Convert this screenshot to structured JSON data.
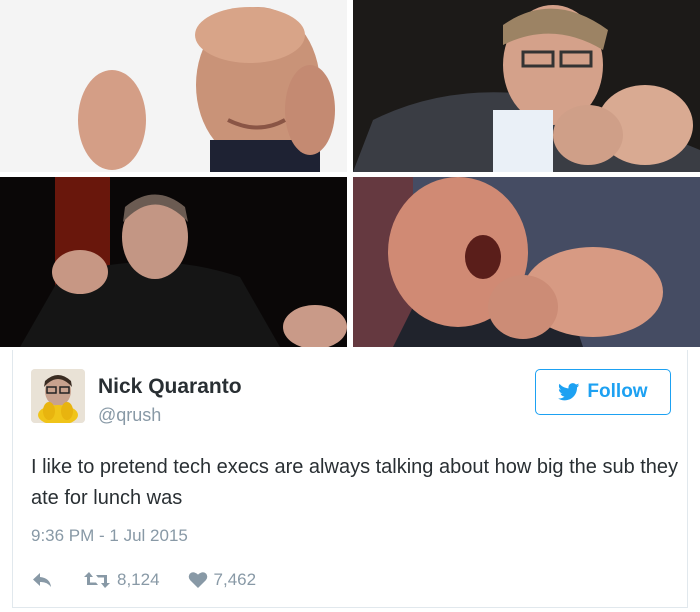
{
  "photos": [
    {
      "subject": "person-photo-1"
    },
    {
      "subject": "person-photo-2"
    },
    {
      "subject": "person-photo-3"
    },
    {
      "subject": "person-photo-4"
    }
  ],
  "tweet": {
    "display_name": "Nick Quaranto",
    "handle": "@qrush",
    "follow_label": "Follow",
    "text": "I like to pretend tech execs are always talking about how big the sub they ate for lunch was",
    "timestamp": "9:36 PM - 1 Jul 2015",
    "retweets": "8,124",
    "likes": "7,462"
  },
  "icons": {
    "follow": "twitter-bird-icon",
    "reply": "reply-icon",
    "retweet": "retweet-icon",
    "like": "heart-icon"
  },
  "colors": {
    "accent": "#1da1f2",
    "text": "#292f33",
    "muted": "#8899a6",
    "border": "#e1e8ed"
  }
}
